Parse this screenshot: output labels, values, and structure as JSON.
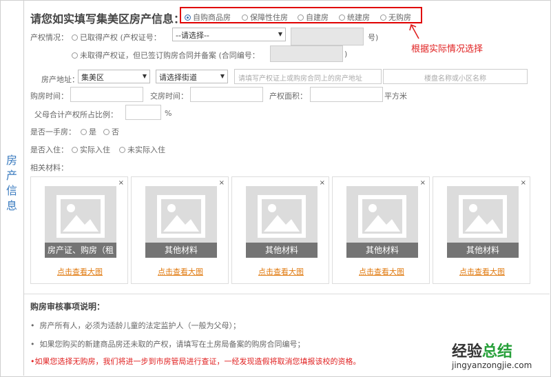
{
  "side_label": "房产信息",
  "title": "请您如实填写集美区房产信息：",
  "house_types": [
    "自购商品房",
    "保障性住房",
    "自建房",
    "统建房",
    "无购房"
  ],
  "annotation": "根据实际情况选择",
  "property": {
    "label": "产权情况：",
    "opt1": "已取得产权 (产权证号：",
    "select1": "--请选择--",
    "suffix1": "号)",
    "opt2": "未取得产权证，但已签订购房合同并备案 (合同编号：",
    "suffix2": ")"
  },
  "address": {
    "label": "房产地址：",
    "district": "集美区",
    "street": "请选择街道",
    "addr_placeholder": "请填写产权证上或购房合同上的房产地址",
    "building_placeholder": "楼盘名称或小区名称"
  },
  "row4": {
    "buy_time": "购房时间：",
    "deliver_time": "交房时间：",
    "area": "产权面积：",
    "area_unit": "平方米"
  },
  "ratio": {
    "label": "父母合计产权所占比例：",
    "unit": "%"
  },
  "first_hand": {
    "label": "是否一手房：",
    "yes": "是",
    "no": "否"
  },
  "occupancy": {
    "label": "是否入住：",
    "yes": "实际入住",
    "no": "未实际入住"
  },
  "materials": {
    "label": "相关材料：",
    "cards": [
      {
        "caption": "房产证、购房（租",
        "link": "点击查看大图"
      },
      {
        "caption": "其他材料",
        "link": "点击查看大图"
      },
      {
        "caption": "其他材料",
        "link": "点击查看大图"
      },
      {
        "caption": "其他材料",
        "link": "点击查看大图"
      },
      {
        "caption": "其他材料",
        "link": "点击查看大图"
      }
    ]
  },
  "notes": {
    "title": "购房审核事项说明：",
    "items": [
      "房产所有人，必须为适龄儿童的法定监护人（一般为父母）；",
      "如果您购买的新建商品房还未取的产权，请填写在土房局备案的购房合同编号；"
    ],
    "warning": "•如果您选择无购房，我们将进一步到市房管局进行查证，一经发现造假将取消您填报该校的资格。"
  },
  "watermark": {
    "cn_a": "经验",
    "cn_b": "总结",
    "url": "jingyanzongjie.com"
  }
}
